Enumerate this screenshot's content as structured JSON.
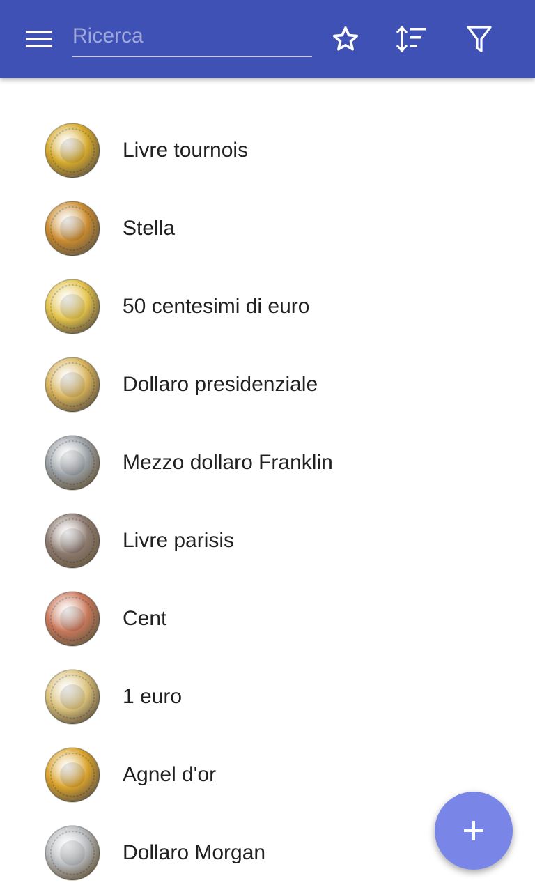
{
  "toolbar": {
    "search_placeholder": "Ricerca",
    "search_value": "",
    "menu_icon": "menu-icon",
    "favorite_icon": "star-outline-icon",
    "sort_icon": "sort-icon",
    "filter_icon": "filter-icon"
  },
  "coins": [
    {
      "label": "Livre tournois",
      "icon": "coin-livre-tournois-icon",
      "color": "#d4a82a"
    },
    {
      "label": "Stella",
      "icon": "coin-stella-icon",
      "color": "#c98a2e"
    },
    {
      "label": "50 centesimi di euro",
      "icon": "coin-50-cent-euro-icon",
      "color": "#e2c24a"
    },
    {
      "label": "Dollaro presidenziale",
      "icon": "coin-presidential-dollar-icon",
      "color": "#d6b25a"
    },
    {
      "label": "Mezzo dollaro Franklin",
      "icon": "coin-franklin-half-dollar-icon",
      "color": "#9aa0a6"
    },
    {
      "label": "Livre parisis",
      "icon": "coin-livre-parisis-icon",
      "color": "#8d7a70"
    },
    {
      "label": "Cent",
      "icon": "coin-cent-icon",
      "color": "#c8775a"
    },
    {
      "label": "1 euro",
      "icon": "coin-1-euro-icon",
      "color": "#d9c07a"
    },
    {
      "label": "Agnel d'or",
      "icon": "coin-agnel-dor-icon",
      "color": "#d9a22a"
    },
    {
      "label": "Dollaro Morgan",
      "icon": "coin-morgan-dollar-icon",
      "color": "#b5b8bb"
    }
  ],
  "fab": {
    "icon": "plus-icon"
  },
  "colors": {
    "primary": "#3f51b5",
    "accent": "#7986e8"
  }
}
